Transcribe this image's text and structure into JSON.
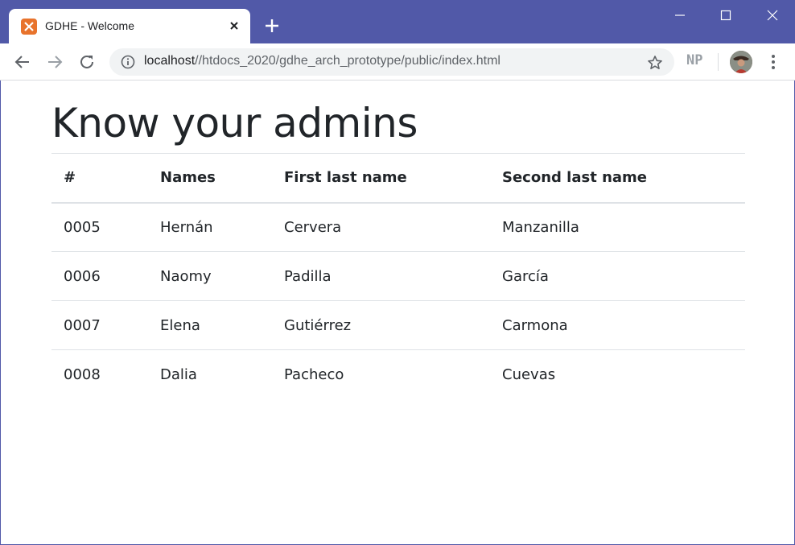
{
  "tab": {
    "title": "GDHE - Welcome",
    "favicon": "xampp-icon"
  },
  "address_bar": {
    "host": "localhost",
    "path": "//htdocs_2020/gdhe_arch_prototype/public/index.html"
  },
  "extension": {
    "label": "NP"
  },
  "page": {
    "heading": "Know your admins",
    "table": {
      "headers": [
        "#",
        "Names",
        "First last name",
        "Second last name"
      ],
      "rows": [
        [
          "0005",
          "Hernán",
          "Cervera",
          "Manzanilla"
        ],
        [
          "0006",
          "Naomy",
          "Padilla",
          "García"
        ],
        [
          "0007",
          "Elena",
          "Gutiérrez",
          "Carmona"
        ],
        [
          "0008",
          "Dalia",
          "Pacheco",
          "Cuevas"
        ]
      ]
    }
  },
  "colors": {
    "titlebar": "#5159a8",
    "favicon": "#e8732c",
    "text": "#212529",
    "border": "#dee2e6"
  }
}
